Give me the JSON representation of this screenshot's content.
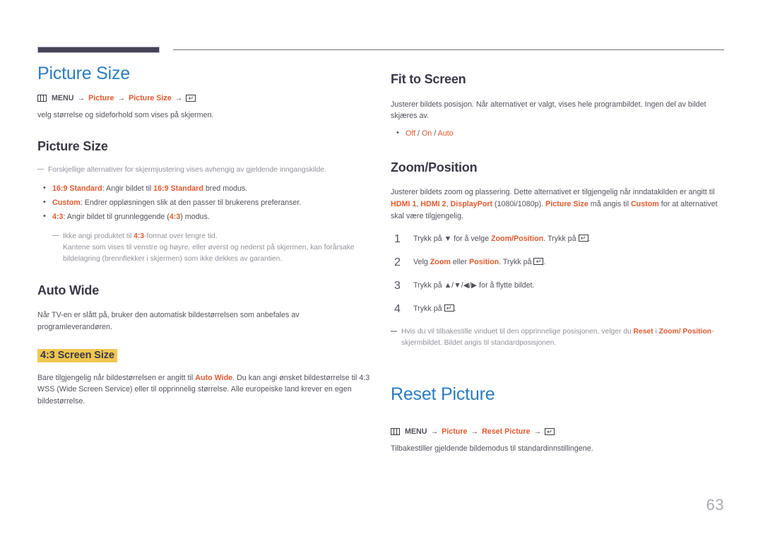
{
  "page": {
    "number": "63",
    "accent_blue": "#2b7cc0",
    "accent_orange": "#e2592f",
    "highlight_yellow": "#efc751",
    "rule_dark": "#454356"
  },
  "left_column": {
    "chapter_title": "Picture Size",
    "menu_path": {
      "menu_label": "MENU",
      "arrow": "→",
      "step1": "Picture",
      "step2": "Picture Size",
      "enter_icon": "enter-key-icon",
      "menu_icon": "menu-grid-icon"
    },
    "intro": "velg størrelse og sideforhold som vises på skjermen.",
    "section_picture_size": {
      "title": "Picture Size",
      "note": "Forskjellige alternativer for skjermjustering vises avhengig av gjeldende inngangskilde.",
      "bullets": [
        {
          "term": "16:9 Standard",
          "text_before_inline": ": Angir bildet til ",
          "inline": "16:9 Standard",
          "text_after_inline": " bred modus."
        },
        {
          "term": "Custom",
          "text_before_inline": ": Endrer oppløsningen slik at den passer til brukerens preferanser.",
          "inline": "",
          "text_after_inline": ""
        },
        {
          "term": "4:3",
          "text_before_inline": ": Angir bildet til grunnleggende (",
          "inline": "4:3",
          "text_after_inline": ") modus."
        }
      ],
      "subnote_line1_a": "Ikke angi produktet til ",
      "subnote_line1_term": "4:3",
      "subnote_line1_b": "-format over lengre tid.",
      "subnote_line2": "Kantene som vises til venstre og høyre, eller øverst og nederst på skjermen, kan forårsake bildelagring (brennflekker i skjermen) som ikke dekkes av garantien."
    },
    "section_auto_wide": {
      "title": "Auto Wide",
      "body": "Når TV-en er slått på, bruker den automatisk bildestørrelsen som anbefales av programleverandøren."
    },
    "section_screen_size": {
      "title": "4:3 Screen Size",
      "body_a": "Bare tilgjengelig når bildestørrelsen er angitt til ",
      "body_term": "Auto Wide",
      "body_b": ". Du kan angi ønsket bildestørrelse til 4:3 WSS (Wide Screen Service) eller til opprinnelig størrelse. Alle europeiske land krever en egen bildestørrelse."
    }
  },
  "right_column": {
    "section_fit_to_screen": {
      "title": "Fit to Screen",
      "body": "Justerer bildets posisjon. Når alternativet er valgt, vises hele programbildet. Ingen del av bildet skjæres av.",
      "bullet_options": [
        "Off",
        "On",
        "Auto"
      ],
      "bullet_separator": " / "
    },
    "section_zoom_position": {
      "title": "Zoom/Position",
      "body_p1": "Justerer bildets zoom og plassering. Dette alternativet er tilgjengelig når inndatakilden er angitt til ",
      "body_t1": "HDMI 1",
      "body_p2": ", ",
      "body_t2": "HDMI 2",
      "body_p3": ", ",
      "body_t3": "DisplayPort",
      "body_p4": " (1080i/1080p). ",
      "body_t4": "Picture Size",
      "body_p5": " må angis til ",
      "body_t5": "Custom",
      "body_p6": " for at alternativet skal være tilgjengelig.",
      "steps": [
        {
          "num": "1",
          "a": "Trykk på ",
          "glyph1": "▼",
          "b": " for å velge ",
          "term": "Zoom/Position",
          "c": ". Trykk på ",
          "enter": "enter-key-icon",
          "d": "."
        },
        {
          "num": "2",
          "a": "Velg ",
          "term": "Zoom",
          "b": " eller ",
          "term2": "Position",
          "c": ". Trykk på ",
          "enter": "enter-key-icon",
          "d": "."
        },
        {
          "num": "3",
          "a": "Trykk på ",
          "glyphs": "▲/▼/◀/▶",
          "b": " for å flytte bildet."
        },
        {
          "num": "4",
          "a": "Trykk på ",
          "enter": "enter-key-icon",
          "b": "."
        }
      ],
      "footnote_a": "Hvis du vil tilbakestille vinduet til den opprinnelige posisjonen, velger du ",
      "footnote_t1": "Reset",
      "footnote_b": " i ",
      "footnote_t2": "Zoom/ Position",
      "footnote_c": "-skjermbildet. Bildet angis til standardposisjonen."
    },
    "section_reset_picture": {
      "chapter_title": "Reset Picture",
      "menu_path": {
        "menu_label": "MENU",
        "arrow": "→",
        "step1": "Picture",
        "step2": "Reset Picture",
        "enter_icon": "enter-key-icon",
        "menu_icon": "menu-grid-icon"
      },
      "body": "Tilbakestiller gjeldende bildemodus til standardinnstillingene."
    }
  }
}
